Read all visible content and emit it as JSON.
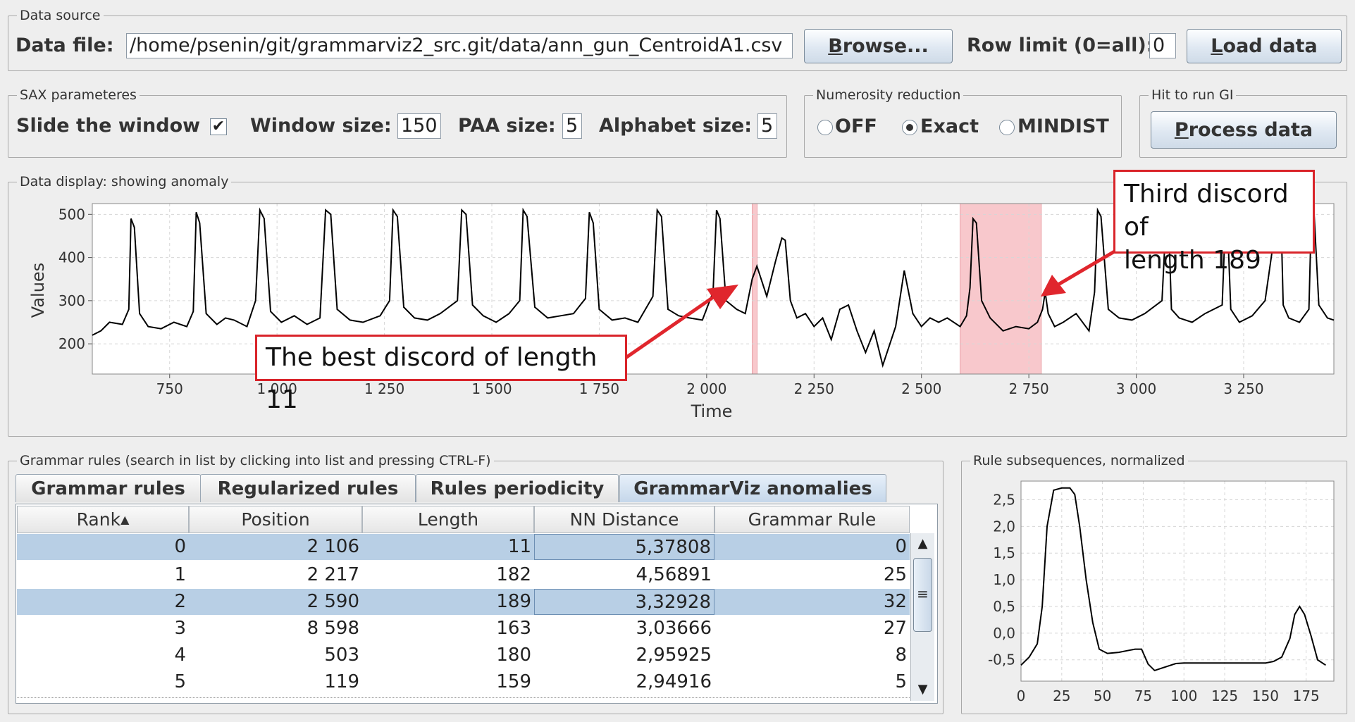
{
  "data_source": {
    "group_title": "Data source",
    "file_label": "Data file:",
    "file_value": "/home/psenin/git/grammarviz2_src.git/data/ann_gun_CentroidA1.csv",
    "browse_label": "rowse...",
    "browse_mnemonic": "B",
    "row_limit_label": "Row limit (0=all):",
    "row_limit_value": "0",
    "load_label": "oad data",
    "load_mnemonic": "L"
  },
  "sax": {
    "group_title": "SAX parameteres",
    "slide_label": "Slide the window",
    "slide_checked": true,
    "checkmark": "✔",
    "window_label": "Window size:",
    "window_value": "150",
    "paa_label": "PAA size:",
    "paa_value": "5",
    "alphabet_label": "Alphabet size:",
    "alphabet_value": "5"
  },
  "numerosity": {
    "group_title": "Numerosity reduction",
    "options": [
      "OFF",
      "Exact",
      "MINDIST"
    ],
    "selected": "Exact"
  },
  "run": {
    "group_title": "Hit to run GI",
    "process_label": "rocess data",
    "process_mnemonic": "P"
  },
  "data_display": {
    "group_title": "Data display: showing anomaly",
    "y_label": "Values",
    "x_label": "Time",
    "callout_best": "The best discord of length 11",
    "callout_third_line1": "Third discord of",
    "callout_third_line2": "length 189"
  },
  "chart_data": [
    {
      "type": "line",
      "xlabel": "Time",
      "ylabel": "Values",
      "xlim": [
        570,
        3460
      ],
      "ylim": [
        130,
        525
      ],
      "x_ticks": [
        750,
        1000,
        1250,
        1500,
        1750,
        2000,
        2250,
        2500,
        2750,
        3000,
        3250
      ],
      "x_tick_labels": [
        "750",
        "1 000",
        "1 250",
        "1 500",
        "1 750",
        "2 000",
        "2 250",
        "2 500",
        "2 750",
        "3 000",
        "3 250"
      ],
      "y_ticks": [
        200,
        300,
        400,
        500
      ],
      "y_tick_labels": [
        "200",
        "300",
        "400",
        "500"
      ],
      "grid": true,
      "highlights": [
        [
          2106,
          2117
        ],
        [
          2590,
          2779
        ]
      ],
      "highlight_color": "#f8c8cc",
      "line_color": "#000000",
      "peaks": [
        660,
        812,
        960,
        1113,
        1270,
        1430,
        1573,
        1727,
        1885,
        2023,
        2183,
        2620,
        2788,
        2910,
        3075,
        3210,
        3337,
        3410
      ],
      "series": [
        {
          "x": [
            570,
            590,
            610,
            640,
            655,
            660,
            668,
            680,
            700,
            730,
            760,
            790,
            805,
            812,
            820,
            835,
            860,
            880,
            900,
            930,
            950,
            960,
            970,
            985,
            1010,
            1040,
            1070,
            1100,
            1113,
            1125,
            1140,
            1170,
            1200,
            1240,
            1262,
            1270,
            1280,
            1295,
            1320,
            1350,
            1380,
            1420,
            1430,
            1440,
            1455,
            1480,
            1510,
            1540,
            1565,
            1573,
            1582,
            1600,
            1630,
            1660,
            1690,
            1718,
            1727,
            1736,
            1750,
            1780,
            1810,
            1840,
            1875,
            1885,
            1895,
            1910,
            1935,
            1960,
            1990,
            2015,
            2023,
            2031,
            2045,
            2070,
            2090,
            2106,
            2117,
            2140,
            2160,
            2175,
            2183,
            2195,
            2210,
            2230,
            2250,
            2270,
            2290,
            2310,
            2330,
            2350,
            2370,
            2390,
            2410,
            2440,
            2460,
            2480,
            2500,
            2520,
            2540,
            2560,
            2590,
            2605,
            2613,
            2620,
            2628,
            2640,
            2660,
            2690,
            2720,
            2750,
            2770,
            2782,
            2788,
            2795,
            2810,
            2830,
            2860,
            2890,
            2903,
            2910,
            2918,
            2935,
            2960,
            2990,
            3020,
            3060,
            3070,
            3075,
            3082,
            3100,
            3130,
            3160,
            3200,
            3208,
            3212,
            3220,
            3240,
            3270,
            3300,
            3330,
            3337,
            3342,
            3355,
            3380,
            3402,
            3408,
            3414,
            3425,
            3445,
            3460
          ],
          "values": [
            220,
            230,
            250,
            245,
            280,
            490,
            470,
            270,
            240,
            235,
            250,
            240,
            275,
            505,
            480,
            270,
            245,
            260,
            255,
            240,
            300,
            510,
            490,
            275,
            250,
            265,
            245,
            260,
            510,
            500,
            280,
            255,
            250,
            265,
            300,
            510,
            495,
            285,
            260,
            255,
            270,
            300,
            510,
            500,
            290,
            265,
            250,
            270,
            300,
            510,
            495,
            285,
            260,
            265,
            270,
            305,
            505,
            480,
            280,
            255,
            260,
            250,
            310,
            510,
            495,
            280,
            265,
            260,
            255,
            320,
            510,
            490,
            300,
            280,
            270,
            350,
            380,
            310,
            390,
            445,
            440,
            300,
            260,
            270,
            240,
            260,
            210,
            280,
            290,
            230,
            180,
            230,
            150,
            240,
            370,
            270,
            240,
            260,
            250,
            260,
            240,
            265,
            330,
            490,
            480,
            300,
            260,
            230,
            240,
            235,
            250,
            280,
            320,
            270,
            240,
            250,
            270,
            230,
            320,
            510,
            495,
            280,
            260,
            255,
            270,
            300,
            500,
            490,
            280,
            260,
            250,
            270,
            290,
            500,
            490,
            280,
            250,
            265,
            300,
            510,
            495,
            290,
            260,
            250,
            280,
            510,
            500,
            290,
            260,
            255
          ]
        }
      ]
    },
    {
      "type": "line",
      "title": "",
      "xlim": [
        0,
        192
      ],
      "ylim": [
        -0.9,
        2.85
      ],
      "x_ticks": [
        0,
        25,
        50,
        75,
        100,
        125,
        150,
        175
      ],
      "x_tick_labels": [
        "0",
        "25",
        "50",
        "75",
        "100",
        "125",
        "150",
        "175"
      ],
      "y_ticks": [
        -0.5,
        0.0,
        0.5,
        1.0,
        1.5,
        2.0,
        2.5
      ],
      "y_tick_labels": [
        "-0,5",
        "0,0",
        "0,5",
        "1,0",
        "1,5",
        "2,0",
        "2,5"
      ],
      "grid": true,
      "series": [
        {
          "x": [
            0,
            5,
            10,
            13,
            16,
            20,
            25,
            30,
            33,
            36,
            40,
            44,
            48,
            53,
            60,
            65,
            70,
            74,
            78,
            82,
            86,
            90,
            95,
            100,
            110,
            120,
            130,
            140,
            150,
            155,
            160,
            165,
            168,
            171,
            174,
            178,
            182,
            187
          ],
          "values": [
            -0.6,
            -0.45,
            -0.2,
            0.5,
            2.0,
            2.68,
            2.72,
            2.72,
            2.6,
            2.0,
            1.0,
            0.2,
            -0.3,
            -0.38,
            -0.36,
            -0.33,
            -0.3,
            -0.3,
            -0.58,
            -0.7,
            -0.66,
            -0.62,
            -0.57,
            -0.56,
            -0.56,
            -0.56,
            -0.56,
            -0.56,
            -0.56,
            -0.53,
            -0.45,
            -0.1,
            0.35,
            0.5,
            0.35,
            -0.05,
            -0.5,
            -0.6
          ]
        }
      ]
    }
  ],
  "rules": {
    "group_title": "Grammar rules (search in list by clicking into list and pressing CTRL-F)",
    "tabs": [
      "Grammar rules",
      "Regularized rules",
      "Rules periodicity",
      "GrammarViz anomalies"
    ],
    "active_tab": "GrammarViz anomalies",
    "columns": [
      "Rank",
      "Position",
      "Length",
      "NN Distance",
      "Grammar Rule"
    ],
    "sort_indicator": "▲",
    "rows": [
      [
        "0",
        "2 106",
        "11",
        "5,37808",
        "0"
      ],
      [
        "1",
        "2 217",
        "182",
        "4,56891",
        "25"
      ],
      [
        "2",
        "2 590",
        "189",
        "3,32928",
        "32"
      ],
      [
        "3",
        "8 598",
        "163",
        "3,03666",
        "27"
      ],
      [
        "4",
        "503",
        "180",
        "2,95925",
        "8"
      ],
      [
        "5",
        "119",
        "159",
        "2,94916",
        "5"
      ]
    ],
    "selected_rows": [
      0,
      2
    ],
    "scroll_up": "▲",
    "scroll_down": "▼",
    "scroll_grip": "≡"
  },
  "subseq": {
    "group_title": "Rule subsequences, normalized"
  }
}
